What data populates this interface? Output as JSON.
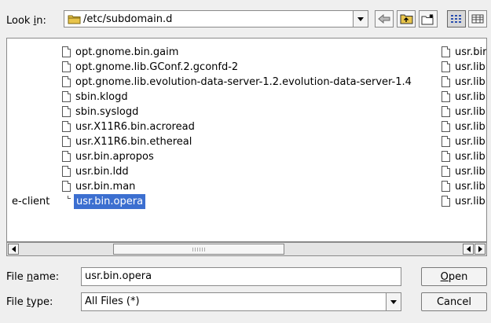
{
  "look_in": {
    "label_pre": "Look ",
    "label_accel": "i",
    "label_post": "n:",
    "path": "/etc/subdomain.d"
  },
  "toolbar": {
    "back_icon": "back-arrow-icon",
    "up_icon": "parent-folder-icon",
    "new_folder_icon": "new-folder-icon",
    "list_view_icon": "list-view-icon",
    "detail_view_icon": "detail-view-icon"
  },
  "file_list": {
    "left_fragment": "e-client",
    "main_column": [
      "opt.gnome.bin.gaim",
      "opt.gnome.lib.GConf.2.gconfd-2",
      "opt.gnome.lib.evolution-data-server-1.2.evolution-data-server-1.4",
      "sbin.klogd",
      "sbin.syslogd",
      "usr.X11R6.bin.acroread",
      "usr.X11R6.bin.ethereal",
      "usr.bin.apropos",
      "usr.bin.ldd",
      "usr.bin.man",
      "usr.bin.opera"
    ],
    "selected_index": 10,
    "right_column": [
      "usr.bir",
      "usr.lib",
      "usr.lib",
      "usr.lib",
      "usr.lib",
      "usr.lib",
      "usr.lib",
      "usr.lib",
      "usr.lib",
      "usr.lib",
      "usr.lib"
    ]
  },
  "file_name": {
    "label_pre": "File ",
    "label_accel": "n",
    "label_post": "ame:",
    "value": "usr.bin.opera"
  },
  "file_type": {
    "label_pre": "File ",
    "label_accel": "t",
    "label_post": "ype:",
    "value": "All Files (*)"
  },
  "buttons": {
    "open_accel": "O",
    "open_rest": "pen",
    "cancel": "Cancel"
  },
  "colors": {
    "selection": "#3c6fd0",
    "folder": "#e8c44a"
  }
}
